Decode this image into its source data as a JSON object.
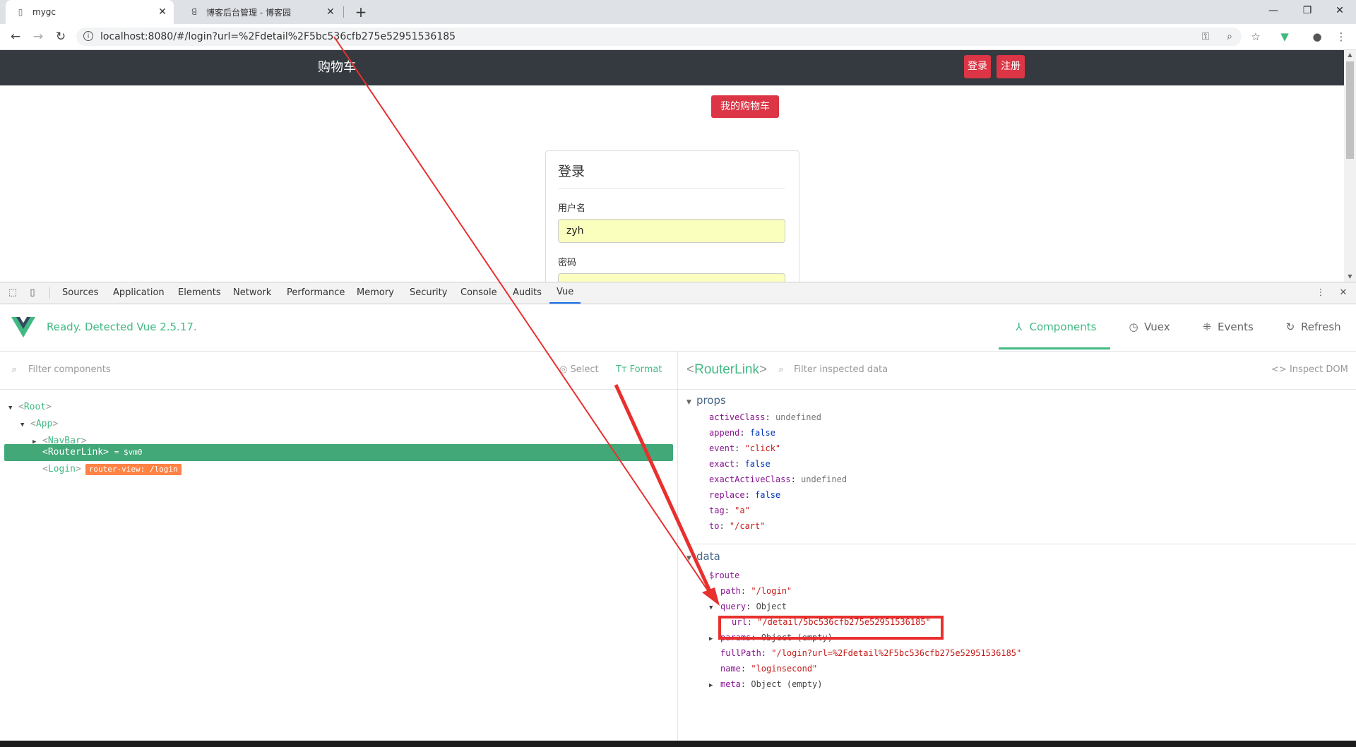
{
  "browser": {
    "tabs": [
      {
        "title": "mygc",
        "icon": "page-icon"
      },
      {
        "title": "博客后台管理 - 博客园",
        "icon": "cnblogs-icon"
      }
    ],
    "url": "localhost:8080/#/login?url=%2Fdetail%2F5bc536cfb275e52951536185"
  },
  "page": {
    "brand": "购物车",
    "login_button": "登录",
    "register_button": "注册",
    "cart_button": "我的购物车",
    "login_form": {
      "title": "登录",
      "username_label": "用户名",
      "username_value": "zyh",
      "password_label": "密码"
    }
  },
  "devtools": {
    "tabs": [
      "Sources",
      "Application",
      "Elements",
      "Network",
      "Performance",
      "Memory",
      "Security",
      "Console",
      "Audits",
      "Vue"
    ],
    "active_tab": "Vue",
    "vue": {
      "status": "Ready. Detected Vue 2.5.17.",
      "nav": [
        "Components",
        "Vuex",
        "Events",
        "Refresh"
      ],
      "left": {
        "filter_placeholder": "Filter components",
        "select_label": "Select",
        "format_label": "Format",
        "tree": [
          {
            "name": "Root"
          },
          {
            "name": "App"
          },
          {
            "name": "NavBar"
          },
          {
            "name": "RouterLink",
            "suffix": "= $vm0"
          },
          {
            "name": "Login",
            "badge": "router-view: /login"
          }
        ]
      },
      "right": {
        "component": "RouterLink",
        "filter_placeholder": "Filter inspected data",
        "inspect_dom": "Inspect DOM",
        "props_title": "props",
        "props": [
          {
            "key": "activeClass",
            "value": "undefined",
            "type": "undef"
          },
          {
            "key": "append",
            "value": "false",
            "type": "bool"
          },
          {
            "key": "event",
            "value": "\"click\"",
            "type": "str"
          },
          {
            "key": "exact",
            "value": "false",
            "type": "bool"
          },
          {
            "key": "exactActiveClass",
            "value": "undefined",
            "type": "undef"
          },
          {
            "key": "replace",
            "value": "false",
            "type": "bool"
          },
          {
            "key": "tag",
            "value": "\"a\"",
            "type": "str"
          },
          {
            "key": "to",
            "value": "\"/cart\"",
            "type": "str"
          }
        ],
        "data_title": "data",
        "route_key": "$route",
        "route": {
          "path_key": "path",
          "path_value": "\"/login\"",
          "query_key": "query",
          "query_value": "Object",
          "url_key": "url",
          "url_value": "\"/detail/5bc536cfb275e52951536185\"",
          "params_key": "params",
          "params_value": "Object (empty)",
          "fullpath_key": "fullPath",
          "fullpath_value": "\"/login?url=%2Fdetail%2F5bc536cfb275e52951536185\"",
          "name_key": "name",
          "name_value": "\"loginsecond\"",
          "meta_key": "meta",
          "meta_value": "Object (empty)"
        }
      }
    }
  },
  "annotation_color": "#e8302f"
}
